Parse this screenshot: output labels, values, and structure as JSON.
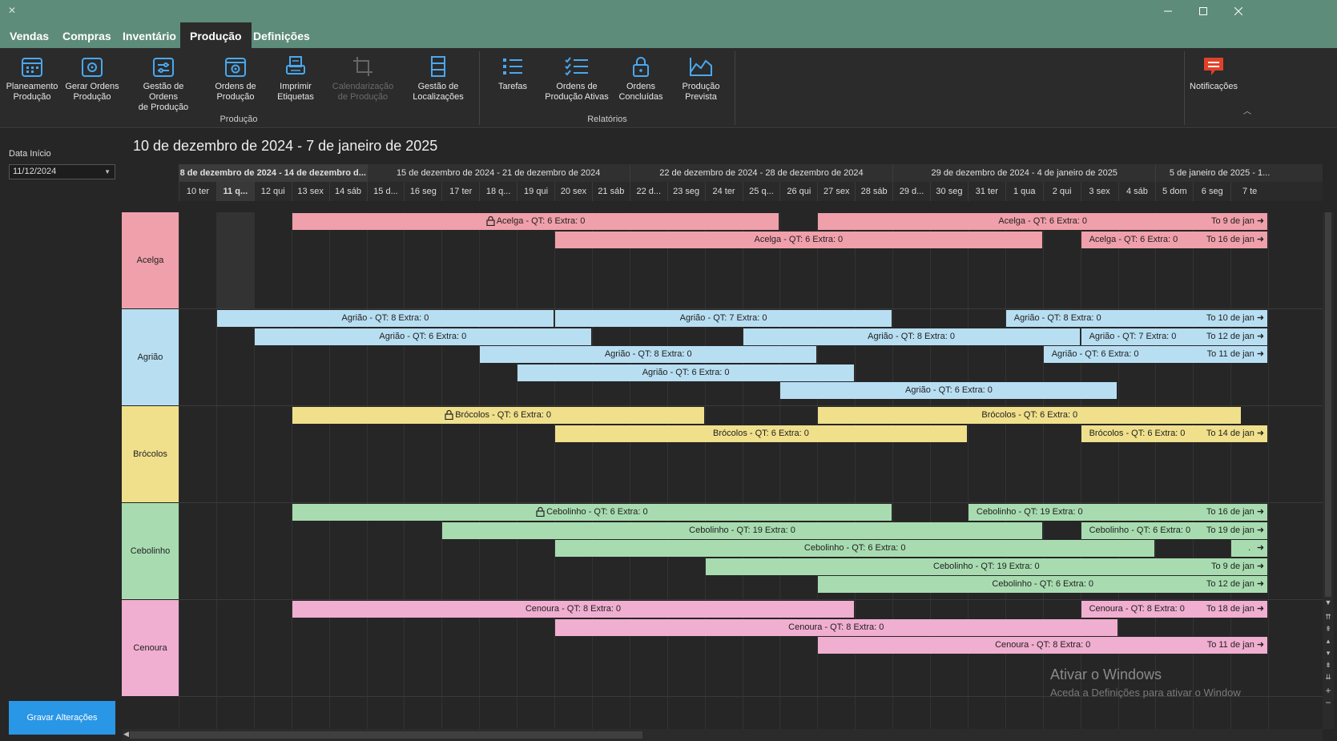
{
  "window": {
    "minimize_icon": "minimize-icon",
    "maximize_icon": "maximize-icon",
    "close_icon": "close-icon"
  },
  "menu": {
    "tabs": [
      {
        "label": "Vendas"
      },
      {
        "label": "Compras"
      },
      {
        "label": "Inventário"
      },
      {
        "label": "Produção",
        "active": true
      },
      {
        "label": "Definições"
      }
    ]
  },
  "ribbon": {
    "buttons": [
      {
        "label": "Planeamento\nProdução",
        "icon": "calendar-grid-icon"
      },
      {
        "label": "Gerar Ordens\nProdução",
        "icon": "gear-calendar-icon"
      },
      {
        "label": "Gestão de Ordens\nde Produção",
        "icon": "sliders-calendar-icon"
      },
      {
        "label": "Ordens de\nProdução",
        "icon": "gear-calendar-icon"
      },
      {
        "label": "Imprimir\nEtiquetas",
        "icon": "printer-icon"
      },
      {
        "label": "Calendarização\nde Produção",
        "icon": "crop-icon",
        "disabled": true
      },
      {
        "label": "Gestão de\nLocalizações",
        "icon": "shelf-icon"
      },
      {
        "label": "Tarefas",
        "icon": "list-icon"
      },
      {
        "label": "Ordens de\nProdução Ativas",
        "icon": "checklist-icon"
      },
      {
        "label": "Ordens\nConcluídas",
        "icon": "lock-icon"
      },
      {
        "label": "Produção\nPrevista",
        "icon": "area-chart-icon"
      },
      {
        "label": "Notificações",
        "icon": "chat-alert-icon"
      }
    ],
    "groups": [
      "Produção",
      "Relatórios"
    ]
  },
  "sidebar": {
    "date_label": "Data Início",
    "date_value": "11/12/2024",
    "save_label": "Gravar Alterações"
  },
  "calendar": {
    "title": "10 de dezembro de 2024 - 7 de janeiro de 2025",
    "weeks": [
      "8 de dezembro de 2024 - 14 de dezembro d...",
      "15 de dezembro de 2024 - 21 de dezembro de 2024",
      "22 de dezembro de 2024 - 28 de dezembro de 2024",
      "29 de dezembro de 2024 - 4 de janeiro de 2025",
      "5 de janeiro de 2025 - 1..."
    ],
    "days": [
      "10 ter",
      "11 q...",
      "12 qui",
      "13 sex",
      "14 sáb",
      "15 d...",
      "16 seg",
      "17 ter",
      "18 q...",
      "19 qui",
      "20 sex",
      "21 sáb",
      "22 d...",
      "23 seg",
      "24 ter",
      "25 q...",
      "26 qui",
      "27 sex",
      "28 sáb",
      "29 d...",
      "30 seg",
      "31 ter",
      "1 qua",
      "2 qui",
      "3 sex",
      "4 sáb",
      "5 dom",
      "6 seg",
      "7 te"
    ],
    "resources": [
      {
        "name": "Acelga",
        "color": "#f0a0aa"
      },
      {
        "name": "Agrião",
        "color": "#b8def2"
      },
      {
        "name": "Brócolos",
        "color": "#f0e08c"
      },
      {
        "name": "Cebolinho",
        "color": "#a8dcb0"
      },
      {
        "name": "Cenoura",
        "color": "#f0aed0"
      }
    ],
    "bars": [
      {
        "res": 0,
        "row": 0,
        "start": 3,
        "end": 16,
        "label": "Acelga - QT: 6  Extra: 0",
        "lock": true
      },
      {
        "res": 0,
        "row": 0,
        "start": 17,
        "end": 29,
        "label": "Acelga - QT: 6  Extra: 0",
        "to": "To 9 de jan"
      },
      {
        "res": 0,
        "row": 1,
        "start": 10,
        "end": 23,
        "label": "Acelga - QT: 6  Extra: 0"
      },
      {
        "res": 0,
        "row": 1,
        "start": 24,
        "end": 29,
        "label": "Acelga - QT: 6  Extra: 0",
        "to": "To 16 de jan",
        "left_label": true
      },
      {
        "res": 1,
        "row": 0,
        "start": 1,
        "end": 10,
        "label": "Agrião - QT: 8  Extra: 0"
      },
      {
        "res": 1,
        "row": 0,
        "start": 10,
        "end": 19,
        "label": "Agrião - QT: 7  Extra: 0"
      },
      {
        "res": 1,
        "row": 0,
        "start": 22,
        "end": 29,
        "label": "Agrião - QT: 8  Extra: 0",
        "to": "To 10 de jan",
        "left_label": true
      },
      {
        "res": 1,
        "row": 1,
        "start": 2,
        "end": 11,
        "label": "Agrião - QT: 6  Extra: 0"
      },
      {
        "res": 1,
        "row": 1,
        "start": 15,
        "end": 24,
        "label": "Agrião - QT: 8  Extra: 0"
      },
      {
        "res": 1,
        "row": 1,
        "start": 24,
        "end": 29,
        "label": "Agrião - QT: 7  Extra: 0",
        "to": "To 12 de jan",
        "left_label": true
      },
      {
        "res": 1,
        "row": 2,
        "start": 8,
        "end": 17,
        "label": "Agrião - QT: 8  Extra: 0"
      },
      {
        "res": 1,
        "row": 2,
        "start": 23,
        "end": 29,
        "label": "Agrião - QT: 6  Extra: 0",
        "to": "To 11 de jan",
        "left_label": true
      },
      {
        "res": 1,
        "row": 3,
        "start": 9,
        "end": 18,
        "label": "Agrião - QT: 6  Extra: 0"
      },
      {
        "res": 1,
        "row": 4,
        "start": 16,
        "end": 25,
        "label": "Agrião - QT: 6  Extra: 0"
      },
      {
        "res": 2,
        "row": 0,
        "start": 3,
        "end": 14,
        "label": "Brócolos - QT: 6  Extra: 0",
        "lock": true
      },
      {
        "res": 2,
        "row": 0,
        "start": 17,
        "end": 28.3,
        "label": "Brócolos - QT: 6  Extra: 0"
      },
      {
        "res": 2,
        "row": 1,
        "start": 10,
        "end": 21,
        "label": "Brócolos - QT: 6  Extra: 0"
      },
      {
        "res": 2,
        "row": 1,
        "start": 24,
        "end": 29,
        "label": "Brócolos - QT: 6  Extra: 0",
        "to": "To 14 de jan",
        "left_label": true
      },
      {
        "res": 3,
        "row": 0,
        "start": 3,
        "end": 19,
        "label": "Cebolinho - QT: 6  Extra: 0",
        "lock": true
      },
      {
        "res": 3,
        "row": 0,
        "start": 21,
        "end": 29,
        "label": "Cebolinho - QT: 19  Extra: 0",
        "to": "To 16 de jan",
        "left_label": true
      },
      {
        "res": 3,
        "row": 1,
        "start": 7,
        "end": 23,
        "label": "Cebolinho - QT: 19  Extra: 0"
      },
      {
        "res": 3,
        "row": 1,
        "start": 24,
        "end": 29,
        "label": "Cebolinho - QT: 6  Extra: 0",
        "to": "To 19 de jan",
        "left_label": true
      },
      {
        "res": 3,
        "row": 2,
        "start": 10,
        "end": 26,
        "label": "Cebolinho - QT: 6  Extra: 0"
      },
      {
        "res": 3,
        "row": 2,
        "start": 28,
        "end": 29,
        "label": ".",
        "to": ""
      },
      {
        "res": 3,
        "row": 3,
        "start": 14,
        "end": 29,
        "label": "Cebolinho - QT: 19  Extra: 0",
        "to": "To 9 de jan"
      },
      {
        "res": 3,
        "row": 4,
        "start": 17,
        "end": 29,
        "label": "Cebolinho - QT: 6  Extra: 0",
        "to": "To 12 de jan"
      },
      {
        "res": 4,
        "row": 0,
        "start": 3,
        "end": 18,
        "label": "Cenoura - QT: 8  Extra: 0"
      },
      {
        "res": 4,
        "row": 0,
        "start": 24,
        "end": 29,
        "label": "Cenoura - QT: 8  Extra: 0",
        "to": "To 18 de jan",
        "left_label": true
      },
      {
        "res": 4,
        "row": 1,
        "start": 10,
        "end": 25,
        "label": "Cenoura - QT: 8  Extra: 0"
      },
      {
        "res": 4,
        "row": 2,
        "start": 17,
        "end": 29,
        "label": "Cenoura - QT: 8  Extra: 0",
        "to": "To 11 de jan"
      }
    ]
  },
  "watermark": {
    "title": "Ativar o Windows",
    "subtitle": "Aceda a Definições para ativar o Window"
  }
}
